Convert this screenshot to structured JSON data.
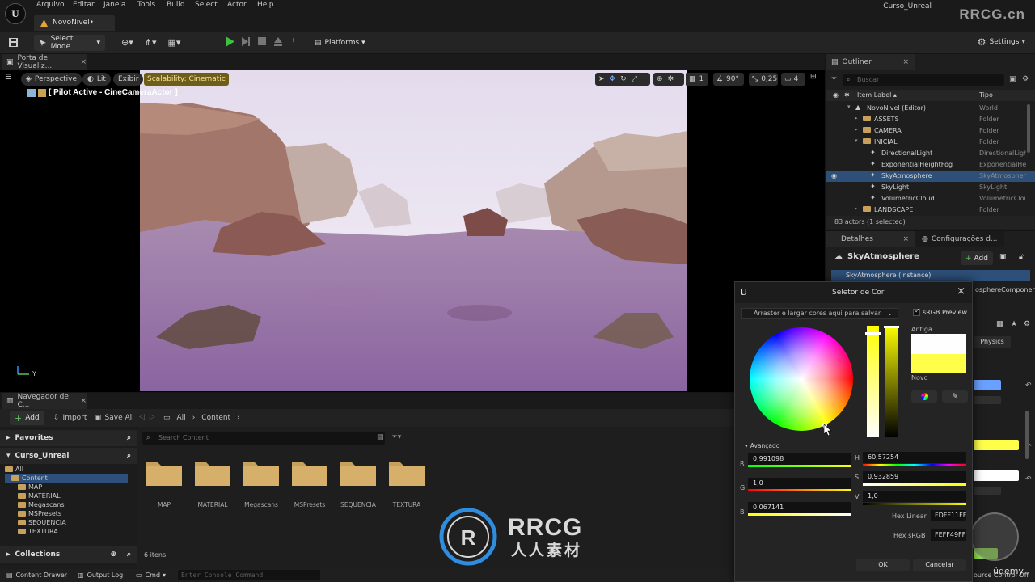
{
  "menu": {
    "items": [
      "Arquivo",
      "Editar",
      "Janela",
      "Tools",
      "Build",
      "Select",
      "Actor",
      "Help"
    ],
    "level_tab": "NovoNivel•",
    "project": "Curso_Unreal",
    "watermark": "RRCG.cn"
  },
  "toolbar": {
    "select_mode": "Select Mode",
    "platforms": "Platforms",
    "settings": "Settings"
  },
  "viewport": {
    "tab": "Porta de Visualiz...",
    "perspective": "Perspective",
    "lit": "Lit",
    "show": "Exibir",
    "scalability": "Scalability: Cinematic",
    "pilot": "[ Pilot Active - CineCameraActor ]",
    "rot_snap": "90°",
    "scale_snap": "0,25",
    "grid_snap": "1",
    "cam_speed": "4",
    "axis_y": "Y"
  },
  "content_browser": {
    "tab": "Navegador de C...",
    "add": "Add",
    "import": "Import",
    "save_all": "Save All",
    "crumb_all": "All",
    "crumb_content": "Content",
    "favorites": "Favorites",
    "project": "Curso_Unreal",
    "tree": [
      {
        "label": "All",
        "depth": 0,
        "selected": false
      },
      {
        "label": "Content",
        "depth": 1,
        "selected": true
      },
      {
        "label": "MAP",
        "depth": 2,
        "selected": false
      },
      {
        "label": "MATERIAL",
        "depth": 2,
        "selected": false
      },
      {
        "label": "Megascans",
        "depth": 2,
        "selected": false
      },
      {
        "label": "MSPresets",
        "depth": 2,
        "selected": false
      },
      {
        "label": "SEQUENCIA",
        "depth": 2,
        "selected": false
      },
      {
        "label": "TEXTURA",
        "depth": 2,
        "selected": false
      },
      {
        "label": "Temp Content",
        "depth": 1,
        "selected": false
      }
    ],
    "collections": "Collections",
    "search_placeholder": "Search Content",
    "assets": [
      "MAP",
      "MATERIAL",
      "Megascans",
      "MSPresets",
      "SEQUENCIA",
      "TEXTURA"
    ],
    "item_count": "6 itens"
  },
  "statusbar": {
    "content_drawer": "Content Drawer",
    "output_log": "Output Log",
    "cmd": "Cmd",
    "console_placeholder": "Enter Console Command",
    "source_control": "ource Control Off"
  },
  "outliner": {
    "tab": "Outliner",
    "search_placeholder": "Buscar",
    "col_label": "Item Label ▴",
    "col_type": "Tipo",
    "rows": [
      {
        "label": "NovoNivel (Editor)",
        "type": "World",
        "indent": 4,
        "selected": false
      },
      {
        "label": "ASSETS",
        "type": "Folder",
        "indent": 5,
        "selected": false
      },
      {
        "label": "CAMERA",
        "type": "Folder",
        "indent": 5,
        "selected": false
      },
      {
        "label": "INICIAL",
        "type": "Folder",
        "indent": 5,
        "selected": false
      },
      {
        "label": "DirectionalLight",
        "type": "DirectionalLigh",
        "indent": 6,
        "selected": false
      },
      {
        "label": "ExponentialHeightFog",
        "type": "ExponentialHe",
        "indent": 6,
        "selected": false
      },
      {
        "label": "SkyAtmosphere",
        "type": "SkyAtmosphere",
        "indent": 6,
        "selected": true
      },
      {
        "label": "SkyLight",
        "type": "SkyLight",
        "indent": 6,
        "selected": false
      },
      {
        "label": "VolumetricCloud",
        "type": "VolumetricClou",
        "indent": 6,
        "selected": false
      },
      {
        "label": "LANDSCAPE",
        "type": "Folder",
        "indent": 5,
        "selected": false
      }
    ],
    "footer": "83 actors (1 selected)"
  },
  "details": {
    "tab": "Detalhes",
    "tab2": "Configurações d...",
    "title": "SkyAtmosphere",
    "add": "Add",
    "instance": "SkyAtmosphere (Instance)",
    "component_fragment": "osphereComponen",
    "physics": "Physics"
  },
  "color_picker": {
    "title": "Seletor de Cor",
    "themes": "Arraster e largar cores aqui para salvar",
    "srgb_preview": "sRGB Preview",
    "old": "Antiga",
    "new": "Novo",
    "advanced": "Avançado",
    "R": {
      "label": "R",
      "value": "0,991098"
    },
    "G": {
      "label": "G",
      "value": "1,0"
    },
    "B": {
      "label": "B",
      "value": "0,067141"
    },
    "H": {
      "label": "H",
      "value": "60,57254"
    },
    "S": {
      "label": "S",
      "value": "0,932859"
    },
    "V": {
      "label": "V",
      "value": "1,0"
    },
    "hex_linear_label": "Hex Linear",
    "hex_linear": "FDFF11FF",
    "hex_srgb_label": "Hex sRGB",
    "hex_srgb": "FEFF49FF",
    "ok": "OK",
    "cancel": "Cancelar",
    "old_color": "#fefefe",
    "new_color": "#ffff49"
  },
  "watermark": {
    "big": "RRCG",
    "sub": "人人素材",
    "udemy": "ûdemy"
  }
}
